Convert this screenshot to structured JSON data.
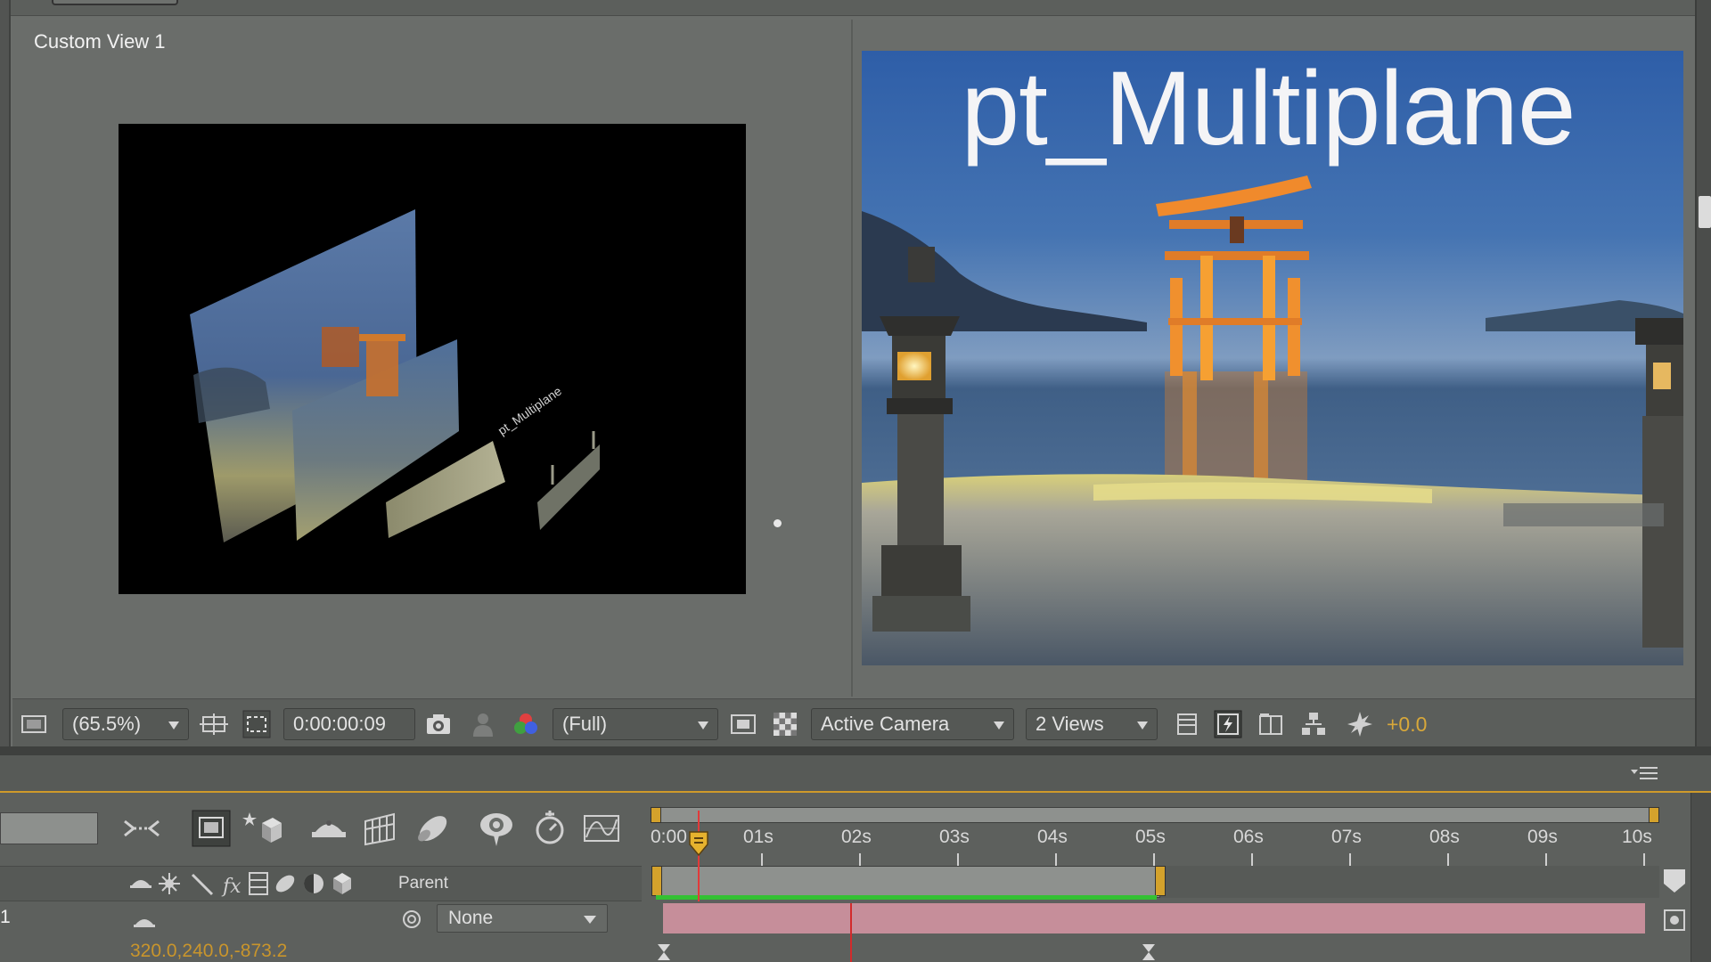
{
  "viewer": {
    "left_view_label": "Custom View 1",
    "render_title": "pt_Multiplane",
    "toolbar": {
      "magnification": "(65.5%)",
      "timecode": "0:00:00:09",
      "resolution": "(Full)",
      "camera": "Active Camera",
      "views": "2 Views",
      "exposure_offset": "+0.0"
    }
  },
  "timeline": {
    "ruler_labels": [
      "0:00",
      "01s",
      "02s",
      "03s",
      "04s",
      "05s",
      "06s",
      "07s",
      "08s",
      "09s",
      "10s"
    ],
    "column_header": {
      "parent": "Parent"
    },
    "layer": {
      "number": "1",
      "parent_value": "None",
      "position": "320.0,240.0,-873.2"
    }
  },
  "colors": {
    "accent": "#d4a22c",
    "cache_bar": "#33c133",
    "layer_bar": "#c68e9a",
    "playhead": "#e23a3a"
  },
  "icons": [
    "view-options-icon",
    "region-of-interest-icon",
    "transparency-grid-icon",
    "snapshot-icon",
    "show-snapshot-icon",
    "channel-icon",
    "fast-preview-icon",
    "flowchart-icon",
    "reset-exposure-icon",
    "shy-layers-icon",
    "draft-3d-icon",
    "graph-editor-icon",
    "brainstorm-icon"
  ]
}
